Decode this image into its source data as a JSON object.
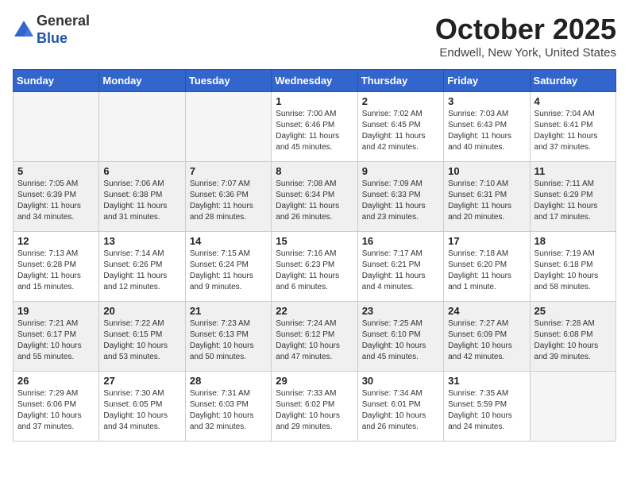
{
  "header": {
    "logo_line1": "General",
    "logo_line2": "Blue",
    "month_title": "October 2025",
    "location": "Endwell, New York, United States"
  },
  "weekdays": [
    "Sunday",
    "Monday",
    "Tuesday",
    "Wednesday",
    "Thursday",
    "Friday",
    "Saturday"
  ],
  "weeks": [
    [
      {
        "day": "",
        "text": ""
      },
      {
        "day": "",
        "text": ""
      },
      {
        "day": "",
        "text": ""
      },
      {
        "day": "1",
        "text": "Sunrise: 7:00 AM\nSunset: 6:46 PM\nDaylight: 11 hours\nand 45 minutes."
      },
      {
        "day": "2",
        "text": "Sunrise: 7:02 AM\nSunset: 6:45 PM\nDaylight: 11 hours\nand 42 minutes."
      },
      {
        "day": "3",
        "text": "Sunrise: 7:03 AM\nSunset: 6:43 PM\nDaylight: 11 hours\nand 40 minutes."
      },
      {
        "day": "4",
        "text": "Sunrise: 7:04 AM\nSunset: 6:41 PM\nDaylight: 11 hours\nand 37 minutes."
      }
    ],
    [
      {
        "day": "5",
        "text": "Sunrise: 7:05 AM\nSunset: 6:39 PM\nDaylight: 11 hours\nand 34 minutes."
      },
      {
        "day": "6",
        "text": "Sunrise: 7:06 AM\nSunset: 6:38 PM\nDaylight: 11 hours\nand 31 minutes."
      },
      {
        "day": "7",
        "text": "Sunrise: 7:07 AM\nSunset: 6:36 PM\nDaylight: 11 hours\nand 28 minutes."
      },
      {
        "day": "8",
        "text": "Sunrise: 7:08 AM\nSunset: 6:34 PM\nDaylight: 11 hours\nand 26 minutes."
      },
      {
        "day": "9",
        "text": "Sunrise: 7:09 AM\nSunset: 6:33 PM\nDaylight: 11 hours\nand 23 minutes."
      },
      {
        "day": "10",
        "text": "Sunrise: 7:10 AM\nSunset: 6:31 PM\nDaylight: 11 hours\nand 20 minutes."
      },
      {
        "day": "11",
        "text": "Sunrise: 7:11 AM\nSunset: 6:29 PM\nDaylight: 11 hours\nand 17 minutes."
      }
    ],
    [
      {
        "day": "12",
        "text": "Sunrise: 7:13 AM\nSunset: 6:28 PM\nDaylight: 11 hours\nand 15 minutes."
      },
      {
        "day": "13",
        "text": "Sunrise: 7:14 AM\nSunset: 6:26 PM\nDaylight: 11 hours\nand 12 minutes."
      },
      {
        "day": "14",
        "text": "Sunrise: 7:15 AM\nSunset: 6:24 PM\nDaylight: 11 hours\nand 9 minutes."
      },
      {
        "day": "15",
        "text": "Sunrise: 7:16 AM\nSunset: 6:23 PM\nDaylight: 11 hours\nand 6 minutes."
      },
      {
        "day": "16",
        "text": "Sunrise: 7:17 AM\nSunset: 6:21 PM\nDaylight: 11 hours\nand 4 minutes."
      },
      {
        "day": "17",
        "text": "Sunrise: 7:18 AM\nSunset: 6:20 PM\nDaylight: 11 hours\nand 1 minute."
      },
      {
        "day": "18",
        "text": "Sunrise: 7:19 AM\nSunset: 6:18 PM\nDaylight: 10 hours\nand 58 minutes."
      }
    ],
    [
      {
        "day": "19",
        "text": "Sunrise: 7:21 AM\nSunset: 6:17 PM\nDaylight: 10 hours\nand 55 minutes."
      },
      {
        "day": "20",
        "text": "Sunrise: 7:22 AM\nSunset: 6:15 PM\nDaylight: 10 hours\nand 53 minutes."
      },
      {
        "day": "21",
        "text": "Sunrise: 7:23 AM\nSunset: 6:13 PM\nDaylight: 10 hours\nand 50 minutes."
      },
      {
        "day": "22",
        "text": "Sunrise: 7:24 AM\nSunset: 6:12 PM\nDaylight: 10 hours\nand 47 minutes."
      },
      {
        "day": "23",
        "text": "Sunrise: 7:25 AM\nSunset: 6:10 PM\nDaylight: 10 hours\nand 45 minutes."
      },
      {
        "day": "24",
        "text": "Sunrise: 7:27 AM\nSunset: 6:09 PM\nDaylight: 10 hours\nand 42 minutes."
      },
      {
        "day": "25",
        "text": "Sunrise: 7:28 AM\nSunset: 6:08 PM\nDaylight: 10 hours\nand 39 minutes."
      }
    ],
    [
      {
        "day": "26",
        "text": "Sunrise: 7:29 AM\nSunset: 6:06 PM\nDaylight: 10 hours\nand 37 minutes."
      },
      {
        "day": "27",
        "text": "Sunrise: 7:30 AM\nSunset: 6:05 PM\nDaylight: 10 hours\nand 34 minutes."
      },
      {
        "day": "28",
        "text": "Sunrise: 7:31 AM\nSunset: 6:03 PM\nDaylight: 10 hours\nand 32 minutes."
      },
      {
        "day": "29",
        "text": "Sunrise: 7:33 AM\nSunset: 6:02 PM\nDaylight: 10 hours\nand 29 minutes."
      },
      {
        "day": "30",
        "text": "Sunrise: 7:34 AM\nSunset: 6:01 PM\nDaylight: 10 hours\nand 26 minutes."
      },
      {
        "day": "31",
        "text": "Sunrise: 7:35 AM\nSunset: 5:59 PM\nDaylight: 10 hours\nand 24 minutes."
      },
      {
        "day": "",
        "text": ""
      }
    ]
  ]
}
